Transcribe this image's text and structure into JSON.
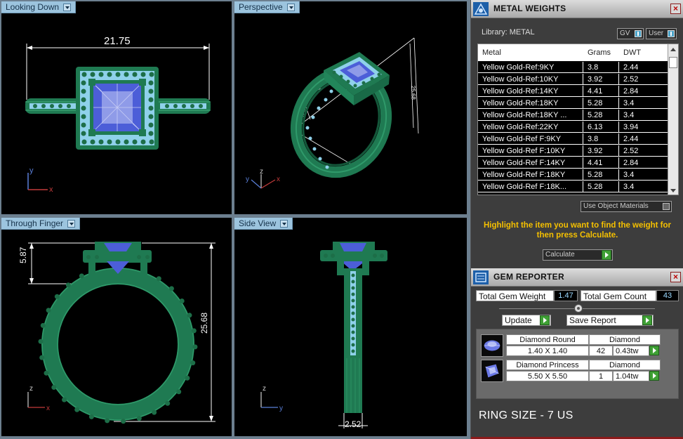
{
  "viewports": {
    "top": {
      "title": "Looking Down",
      "dim": "21.75",
      "axis_y": "y",
      "axis_x": "x"
    },
    "perspective": {
      "title": "Perspective",
      "dim_a": "6.91",
      "dim_b": "25.68",
      "axis_z": "z",
      "axis_y": "y",
      "axis_x": "x"
    },
    "front": {
      "title": "Through Finger",
      "dim_height": "5.87",
      "dim_total": "25.68",
      "axis_z": "z",
      "axis_x": "x"
    },
    "side": {
      "title": "Side View",
      "dim_width": "2.52",
      "axis_z": "z",
      "axis_y": "y"
    }
  },
  "metal_weights": {
    "title": "METAL WEIGHTS",
    "library_label": "Library: METAL",
    "gv_label": "GV",
    "user_label": "User",
    "columns": [
      "Metal",
      "Grams",
      "DWT"
    ],
    "rows": [
      {
        "metal": "Yellow Gold-Ref:9KY",
        "grams": "3.8",
        "dwt": "2.44"
      },
      {
        "metal": "Yellow Gold-Ref:10KY",
        "grams": "3.92",
        "dwt": "2.52"
      },
      {
        "metal": "Yellow Gold-Ref:14KY",
        "grams": "4.41",
        "dwt": "2.84"
      },
      {
        "metal": "Yellow Gold-Ref:18KY",
        "grams": "5.28",
        "dwt": "3.4"
      },
      {
        "metal": "Yellow Gold-Ref:18KY ...",
        "grams": "5.28",
        "dwt": "3.4"
      },
      {
        "metal": "Yellow Gold-Ref:22KY",
        "grams": "6.13",
        "dwt": "3.94"
      },
      {
        "metal": "Yellow Gold-Ref F:9KY",
        "grams": "3.8",
        "dwt": "2.44"
      },
      {
        "metal": "Yellow Gold-Ref F:10KY",
        "grams": "3.92",
        "dwt": "2.52"
      },
      {
        "metal": "Yellow Gold-Ref F:14KY",
        "grams": "4.41",
        "dwt": "2.84"
      },
      {
        "metal": "Yellow Gold-Ref F:18KY",
        "grams": "5.28",
        "dwt": "3.4"
      },
      {
        "metal": "Yellow Gold-Ref F:18K...",
        "grams": "5.28",
        "dwt": "3.4"
      }
    ],
    "use_object_materials": "Use Object Materials",
    "hint": "Highlight the item you want to find the weight for then press Calculate.",
    "calculate_label": "Calculate"
  },
  "gem_reporter": {
    "title": "GEM REPORTER",
    "total_weight_label": "Total Gem Weight",
    "total_weight_value": "1.47",
    "total_count_label": "Total Gem Count",
    "total_count_value": "43",
    "update_label": "Update",
    "save_report_label": "Save Report",
    "gems": [
      {
        "name": "Diamond Round",
        "type": "Diamond",
        "size": "1.40 X 1.40",
        "count": "42",
        "weight": "0.43tw"
      },
      {
        "name": "Diamond Princess",
        "type": "Diamond",
        "size": "5.50 X 5.50",
        "count": "1",
        "weight": "1.04tw"
      }
    ]
  },
  "ring_size": "RING SIZE - 7 US",
  "colors": {
    "metal_green": "#23835a",
    "gem_blue": "#4c5ed8",
    "tab_blue": "#9cc4de",
    "hint_yellow": "#f5c000"
  }
}
